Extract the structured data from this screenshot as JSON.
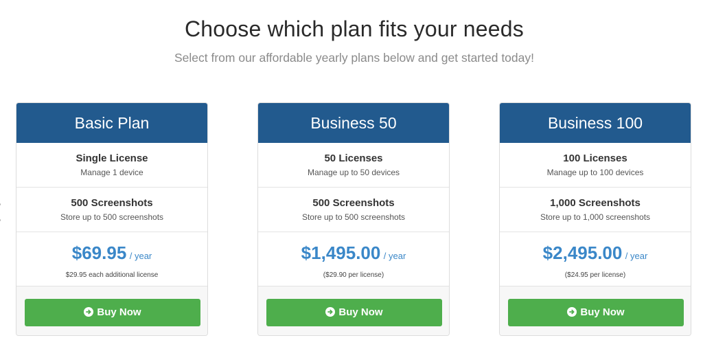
{
  "header": {
    "title": "Choose which plan fits your needs",
    "subtitle": "Select from our affordable yearly plans below and get started today!"
  },
  "colors": {
    "header_blue": "#225a8e",
    "price_blue": "#3a87c8",
    "button_green": "#4eae4c"
  },
  "plans": [
    {
      "name": "Basic Plan",
      "licenses_title": "Single License",
      "licenses_sub": "Manage 1 device",
      "screenshots_title": "500 Screenshots",
      "screenshots_sub": "Store up to 500 screenshots",
      "price": "$69.95",
      "period": "/ year",
      "price_note": "$29.95 each additional license",
      "button_label": "Buy Now",
      "button_icon": "arrow-circle-right-icon"
    },
    {
      "name": "Business 50",
      "licenses_title": "50 Licenses",
      "licenses_sub": "Manage up to 50 devices",
      "screenshots_title": "500 Screenshots",
      "screenshots_sub": "Store up to 500 screenshots",
      "price": "$1,495.00",
      "period": "/ year",
      "price_note": "($29.90 per license)",
      "button_label": "Buy Now",
      "button_icon": "arrow-circle-right-icon"
    },
    {
      "name": "Business 100",
      "licenses_title": "100 Licenses",
      "licenses_sub": "Manage up to 100 devices",
      "screenshots_title": "1,000 Screenshots",
      "screenshots_sub": "Store up to 1,000 screenshots",
      "price": "$2,495.00",
      "period": "/ year",
      "price_note": "($24.95 per license)",
      "button_label": "Buy Now",
      "button_icon": "arrow-circle-right-icon"
    }
  ]
}
